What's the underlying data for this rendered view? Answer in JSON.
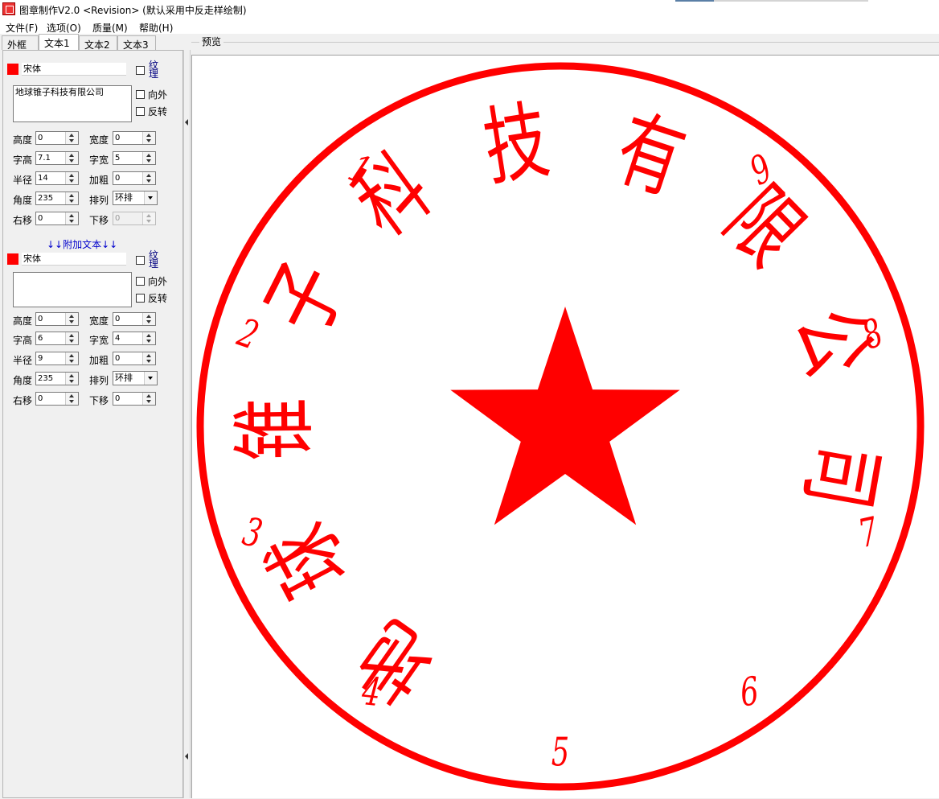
{
  "window": {
    "title": "图章制作V2.0 <Revision> (默认采用中反走样绘制)"
  },
  "menu": [
    "文件(F)",
    "选项(O)",
    "质量(M)",
    "帮助(H)"
  ],
  "tabs": [
    {
      "label": "外框",
      "active": false
    },
    {
      "label": "文本1",
      "active": true
    },
    {
      "label": "文本2",
      "active": false
    },
    {
      "label": "文本3",
      "active": false
    }
  ],
  "main_text": {
    "color": "#ff0000",
    "font": "宋体",
    "texture_label": "纹理",
    "text": "地球锥子科技有限公司",
    "outward_label": "向外",
    "reverse_label": "反转",
    "labels": {
      "height": "高度",
      "width": "宽度",
      "char_height": "字高",
      "char_width": "字宽",
      "radius": "半径",
      "bold": "加粗",
      "angle": "角度",
      "arrange": "排列",
      "shift_right": "右移",
      "shift_down": "下移"
    },
    "height": "0",
    "width": "0",
    "char_height": "7.1",
    "char_width": "5",
    "radius": "14",
    "bold": "0",
    "angle": "235",
    "arrange": "环排",
    "shift_right": "0",
    "shift_down": "0"
  },
  "extra_heading": "↓↓附加文本↓↓",
  "extra_text": {
    "color": "#ff0000",
    "font": "宋体",
    "texture_label": "纹理",
    "text": "",
    "outward_label": "向外",
    "reverse_label": "反转",
    "height": "0",
    "width": "0",
    "char_height": "6",
    "char_width": "4",
    "radius": "9",
    "bold": "0",
    "angle": "235",
    "arrange": "环排",
    "shift_right": "0",
    "shift_down": "0"
  },
  "preview": {
    "label": "预览",
    "seal": {
      "color": "#ff0000",
      "top_chars": [
        "地",
        "球",
        "锥",
        "子",
        "科",
        "技",
        "有",
        "限",
        "公",
        "司"
      ],
      "bottom_chars": [
        "1",
        "2",
        "3",
        "4",
        "5",
        "6",
        "7",
        "8",
        "9"
      ]
    }
  }
}
